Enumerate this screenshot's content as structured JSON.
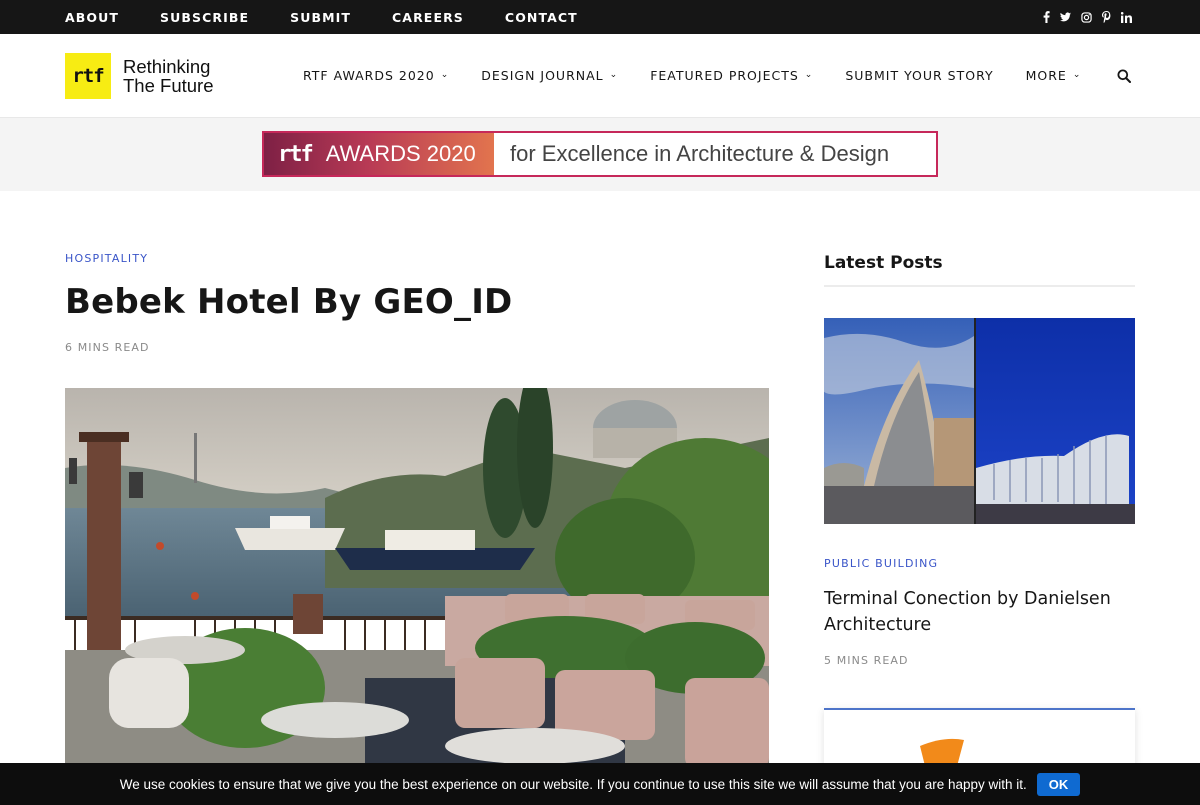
{
  "topbar": {
    "links": [
      "ABOUT",
      "SUBSCRIBE",
      "SUBMIT",
      "CAREERS",
      "CONTACT"
    ],
    "social_icons": [
      "facebook-icon",
      "twitter-icon",
      "instagram-icon",
      "pinterest-icon",
      "linkedin-icon"
    ]
  },
  "header": {
    "logo_mark": "rtf",
    "logo_line1": "Rethinking",
    "logo_line2": "The Future",
    "nav": [
      {
        "label": "RTF AWARDS 2020",
        "has_dropdown": true
      },
      {
        "label": "DESIGN JOURNAL",
        "has_dropdown": true
      },
      {
        "label": "FEATURED PROJECTS",
        "has_dropdown": true
      },
      {
        "label": "SUBMIT YOUR STORY",
        "has_dropdown": false
      },
      {
        "label": "MORE",
        "has_dropdown": true
      }
    ],
    "search_icon": "search-icon"
  },
  "banner": {
    "mark": "rtf",
    "left_text": "AWARDS 2020",
    "right_text": "for Excellence in Architecture & Design",
    "border_color": "#c6285a"
  },
  "article": {
    "category": "HOSPITALITY",
    "title": "Bebek Hotel By GEO_ID",
    "read_time": "6 MINS READ"
  },
  "sidebar": {
    "title": "Latest Posts",
    "post": {
      "category": "PUBLIC BUILDING",
      "title": "Terminal Conection by Danielsen Architecture",
      "read_time": "5 MINS READ"
    }
  },
  "cookie": {
    "text": "We use cookies to ensure that we give you the best experience on our website. If you continue to use this site we will assume that you are happy with it.",
    "ok_label": "OK"
  },
  "colors": {
    "accent_blue": "#3a55c8",
    "logo_yellow": "#f7ec13",
    "topbar_bg": "#161616",
    "cookie_ok": "#0f6ad1"
  }
}
